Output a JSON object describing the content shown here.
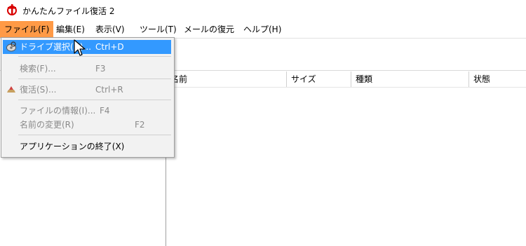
{
  "window": {
    "title": "かんたんファイル復活 2"
  },
  "menubar": {
    "items": [
      {
        "label": "ファイル(F)"
      },
      {
        "label": "編集(E)"
      },
      {
        "label": "表示(V)"
      },
      {
        "label": "ツール(T)"
      },
      {
        "label": "メールの復元"
      },
      {
        "label": "ヘルプ(H)"
      }
    ]
  },
  "file_menu": {
    "items": [
      {
        "label": "ドライブ選択(D)...",
        "shortcut": "Ctrl+D",
        "icon": "drive-select-icon",
        "state": "highlighted"
      },
      {
        "label": "検索(F)...",
        "shortcut": "F3",
        "state": "disabled"
      },
      {
        "label": "復活(S)...",
        "shortcut": "Ctrl+R",
        "icon": "restore-icon",
        "state": "disabled"
      },
      {
        "label": "ファイルの情報(I)...",
        "shortcut": "F4",
        "state": "disabled"
      },
      {
        "label": "名前の変更(R)",
        "shortcut": "F2",
        "state": "disabled"
      },
      {
        "label": "アプリケーションの終了(X)",
        "shortcut": "",
        "state": "enabled"
      }
    ]
  },
  "list": {
    "columns": [
      "名前",
      "サイズ",
      "種類",
      "状態"
    ]
  },
  "colors": {
    "active_menu": "#ff9a46",
    "highlight": "#3399ff",
    "disabled_text": "#8a8a8a"
  }
}
